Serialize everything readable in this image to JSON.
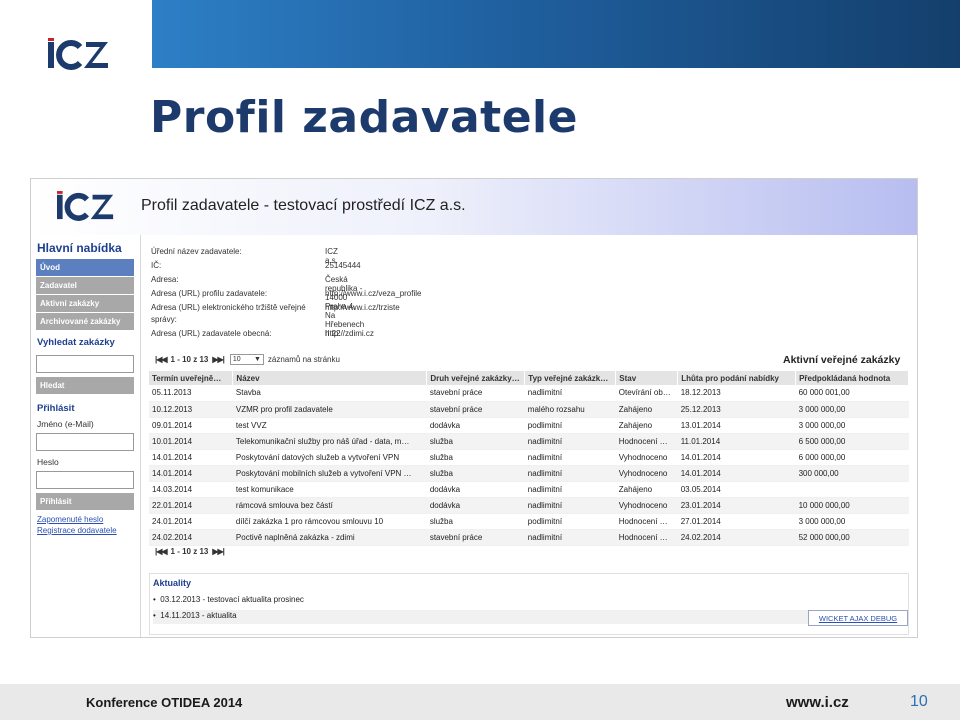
{
  "slide": {
    "title": "Profil zadavatele",
    "footer_left": "Konference OTIDEA 2014",
    "footer_url": "www.i.cz",
    "page_number": "10",
    "brand_colors": {
      "logo_blue": "#1c3a6b",
      "logo_red": "#c8202f"
    }
  },
  "app": {
    "header_title": "Profil zadavatele - testovací prostředí ICZ a.s.",
    "sidebar": {
      "main_heading": "Hlavní nabídka",
      "menu": [
        {
          "label": "Úvod",
          "active": true
        },
        {
          "label": "Zadavatel",
          "active": false
        },
        {
          "label": "Aktivní zakázky",
          "active": false
        },
        {
          "label": "Archivované zakázky",
          "active": false
        }
      ],
      "search_heading": "Vyhledat zakázky",
      "search_button": "Hledat",
      "login_heading": "Přihlásit",
      "name_label": "Jméno (e-Mail)",
      "password_label": "Heslo",
      "login_button": "Přihlásit",
      "forgot_link": "Zapomenuté heslo",
      "register_link": "Registrace dodavatele"
    },
    "info": [
      {
        "key": "Úřední název zadavatele:",
        "value": "ICZ a.s."
      },
      {
        "key": "IČ:",
        "value": "25145444"
      },
      {
        "key": "Adresa:",
        "value": "Česká republika - 14000 Praha 4, Na Hřebenech II 22"
      },
      {
        "key": "Adresa (URL) profilu zadavatele:",
        "value": "http://www.i.cz/veza_profile"
      },
      {
        "key": "Adresa (URL) elektronického tržiště veřejné",
        "value": "http://www.i.cz/trziste"
      },
      {
        "key": "správy:",
        "value": ""
      },
      {
        "key": "Adresa (URL) zadavatele obecná:",
        "value": "http://zdimi.cz"
      }
    ],
    "pager": {
      "first_prev": "|◀◀",
      "range": "1 - 10 z 13",
      "next_last": "▶▶|",
      "page_size": "10",
      "page_size_label": "záznamů na stránku"
    },
    "table_title": "Aktivní veřejné zakázky",
    "columns": [
      "Termín uveřejně…",
      "Název",
      "Druh veřejné zakázky…",
      "Typ veřejné zakázk…",
      "Stav",
      "Lhůta pro podání nabídky",
      "Předpokládaná hodnota"
    ],
    "rows": [
      [
        "05.11.2013",
        "Stavba",
        "stavební práce",
        "nadlimitní",
        "Otevírání ob…",
        "18.12.2013",
        "60 000 001,00"
      ],
      [
        "10.12.2013",
        "VZMR pro profil zadavatele",
        "stavební práce",
        "malého rozsahu",
        "Zahájeno",
        "25.12.2013",
        "3 000 000,00"
      ],
      [
        "09.01.2014",
        "test VVZ",
        "dodávka",
        "podlimitní",
        "Zahájeno",
        "13.01.2014",
        "3 000 000,00"
      ],
      [
        "10.01.2014",
        "Telekomunikační služby pro náš úřad - data, m…",
        "služba",
        "nadlimitní",
        "Hodnocení …",
        "11.01.2014",
        "6 500 000,00"
      ],
      [
        "14.01.2014",
        "Poskytování datových služeb a vytvoření VPN",
        "služba",
        "nadlimitní",
        "Vyhodnoceno",
        "14.01.2014",
        "6 000 000,00"
      ],
      [
        "14.01.2014",
        "Poskytování mobilních služeb a vytvoření VPN …",
        "služba",
        "nadlimitní",
        "Vyhodnoceno",
        "14.01.2014",
        "300 000,00"
      ],
      [
        "14.03.2014",
        "test komunikace",
        "dodávka",
        "nadlimitní",
        "Zahájeno",
        "03.05.2014",
        ""
      ],
      [
        "22.01.2014",
        "rámcová smlouva bez částí",
        "dodávka",
        "nadlimitní",
        "Vyhodnoceno",
        "23.01.2014",
        "10 000 000,00"
      ],
      [
        "24.01.2014",
        "dílčí zakázka 1 pro rámcovou smlouvu 10",
        "služba",
        "podlimitní",
        "Hodnocení …",
        "27.01.2014",
        "3 000 000,00"
      ],
      [
        "24.02.2014",
        "Poctivě naplněná zakázka - zdimi",
        "stavební práce",
        "nadlimitní",
        "Hodnocení …",
        "24.02.2014",
        "52 000 000,00"
      ]
    ],
    "news": {
      "heading": "Aktuality",
      "items": [
        "03.12.2013 - testovací aktualita prosinec",
        "14.11.2013 - aktualita"
      ],
      "debug_link": "WICKET AJAX DEBUG"
    }
  }
}
